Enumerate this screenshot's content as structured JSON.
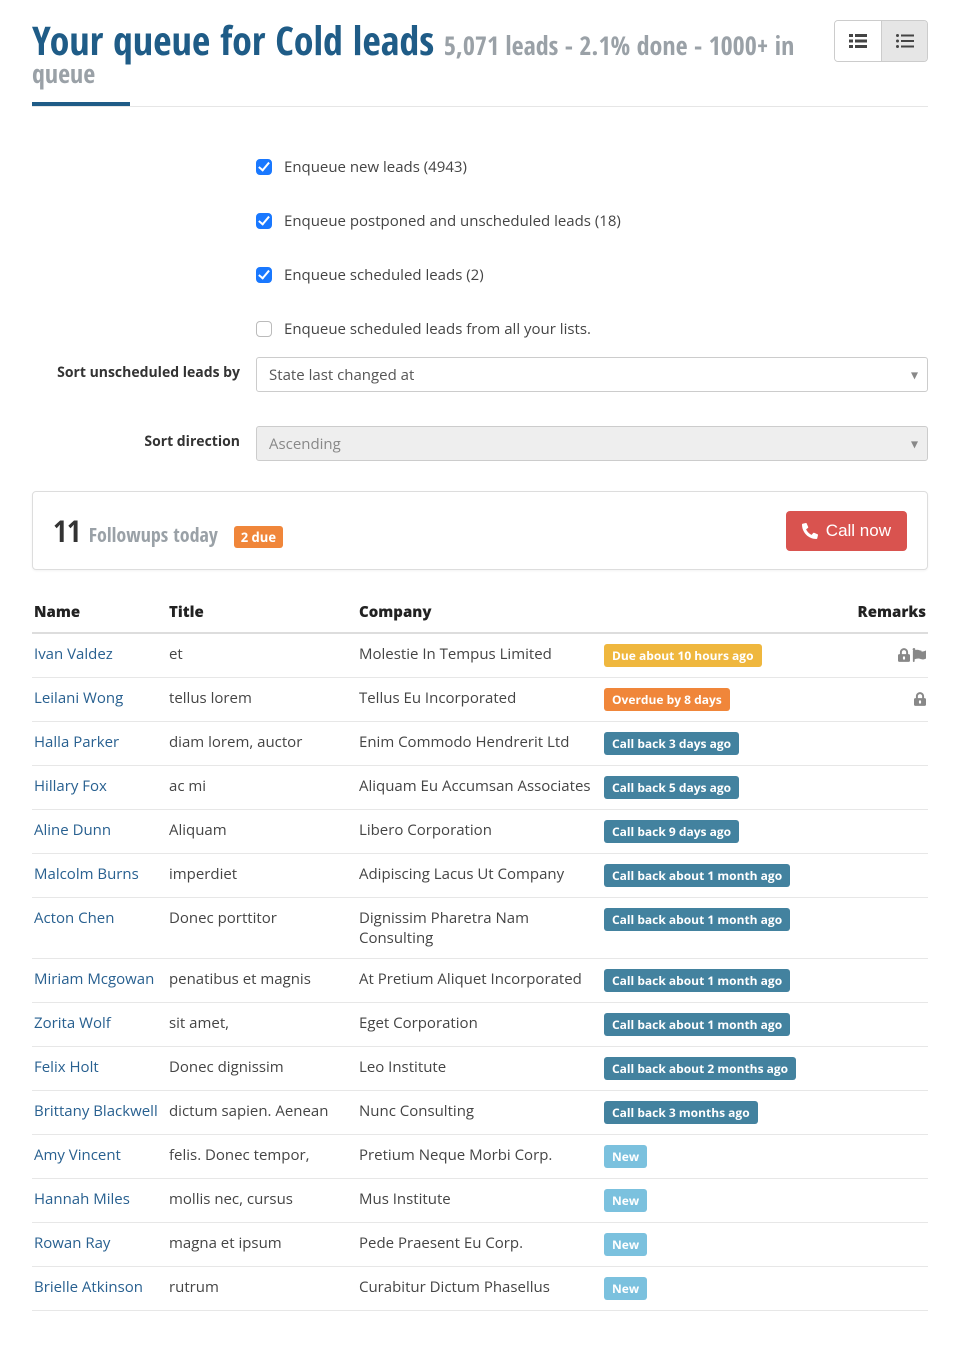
{
  "header": {
    "title": "Your queue for Cold leads",
    "subtitle": "5,071 leads - 2.1% done - 1000+ in queue"
  },
  "filters": {
    "checkboxes": [
      {
        "label": "Enqueue new leads (4943)",
        "checked": true
      },
      {
        "label": "Enqueue postponed and unscheduled leads (18)",
        "checked": true
      },
      {
        "label": "Enqueue scheduled leads (2)",
        "checked": true
      },
      {
        "label": "Enqueue scheduled leads from all your lists.",
        "checked": false
      }
    ],
    "sort_label": "Sort unscheduled leads by",
    "sort_value": "State last changed at",
    "dir_label": "Sort direction",
    "dir_value": "Ascending"
  },
  "panel": {
    "count": "11",
    "text": "Followups today",
    "due_badge": "2 due",
    "call_label": "Call now"
  },
  "table": {
    "headers": {
      "name": "Name",
      "title": "Title",
      "company": "Company",
      "remarks": "Remarks"
    },
    "rows": [
      {
        "name": "Ivan Valdez",
        "title": "et",
        "company": "Molestie In Tempus Limited",
        "status": "Due about 10 hours ago",
        "status_type": "due",
        "lock": true,
        "flag": true
      },
      {
        "name": "Leilani Wong",
        "title": "tellus lorem",
        "company": "Tellus Eu Incorporated",
        "status": "Overdue by 8 days",
        "status_type": "overdue",
        "lock": true,
        "flag": false
      },
      {
        "name": "Halla Parker",
        "title": "diam lorem, auctor",
        "company": "Enim Commodo Hendrerit Ltd",
        "status": "Call back 3 days ago",
        "status_type": "callback",
        "lock": false,
        "flag": false
      },
      {
        "name": "Hillary Fox",
        "title": "ac mi",
        "company": "Aliquam Eu Accumsan Associates",
        "status": "Call back 5 days ago",
        "status_type": "callback",
        "lock": false,
        "flag": false
      },
      {
        "name": "Aline Dunn",
        "title": "Aliquam",
        "company": "Libero Corporation",
        "status": "Call back 9 days ago",
        "status_type": "callback",
        "lock": false,
        "flag": false
      },
      {
        "name": "Malcolm Burns",
        "title": "imperdiet",
        "company": "Adipiscing Lacus Ut Company",
        "status": "Call back about 1 month ago",
        "status_type": "callback",
        "lock": false,
        "flag": false
      },
      {
        "name": "Acton Chen",
        "title": "Donec porttitor",
        "company": "Dignissim Pharetra Nam Consulting",
        "status": "Call back about 1 month ago",
        "status_type": "callback",
        "lock": false,
        "flag": false
      },
      {
        "name": "Miriam Mcgowan",
        "title": "penatibus et magnis",
        "company": "At Pretium Aliquet Incorporated",
        "status": "Call back about 1 month ago",
        "status_type": "callback",
        "lock": false,
        "flag": false
      },
      {
        "name": "Zorita Wolf",
        "title": "sit amet,",
        "company": "Eget Corporation",
        "status": "Call back about 1 month ago",
        "status_type": "callback",
        "lock": false,
        "flag": false
      },
      {
        "name": "Felix Holt",
        "title": "Donec dignissim",
        "company": "Leo Institute",
        "status": "Call back about 2 months ago",
        "status_type": "callback",
        "lock": false,
        "flag": false
      },
      {
        "name": "Brittany Blackwell",
        "title": "dictum sapien. Aenean",
        "company": "Nunc Consulting",
        "status": "Call back 3 months ago",
        "status_type": "callback",
        "lock": false,
        "flag": false
      },
      {
        "name": "Amy Vincent",
        "title": "felis. Donec tempor,",
        "company": "Pretium Neque Morbi Corp.",
        "status": "New",
        "status_type": "new",
        "lock": false,
        "flag": false
      },
      {
        "name": "Hannah Miles",
        "title": "mollis nec, cursus",
        "company": "Mus Institute",
        "status": "New",
        "status_type": "new",
        "lock": false,
        "flag": false
      },
      {
        "name": "Rowan Ray",
        "title": "magna et ipsum",
        "company": "Pede Praesent Eu Corp.",
        "status": "New",
        "status_type": "new",
        "lock": false,
        "flag": false
      },
      {
        "name": "Brielle Atkinson",
        "title": "rutrum",
        "company": "Curabitur Dictum Phasellus",
        "status": "New",
        "status_type": "new",
        "lock": false,
        "flag": false
      }
    ]
  }
}
